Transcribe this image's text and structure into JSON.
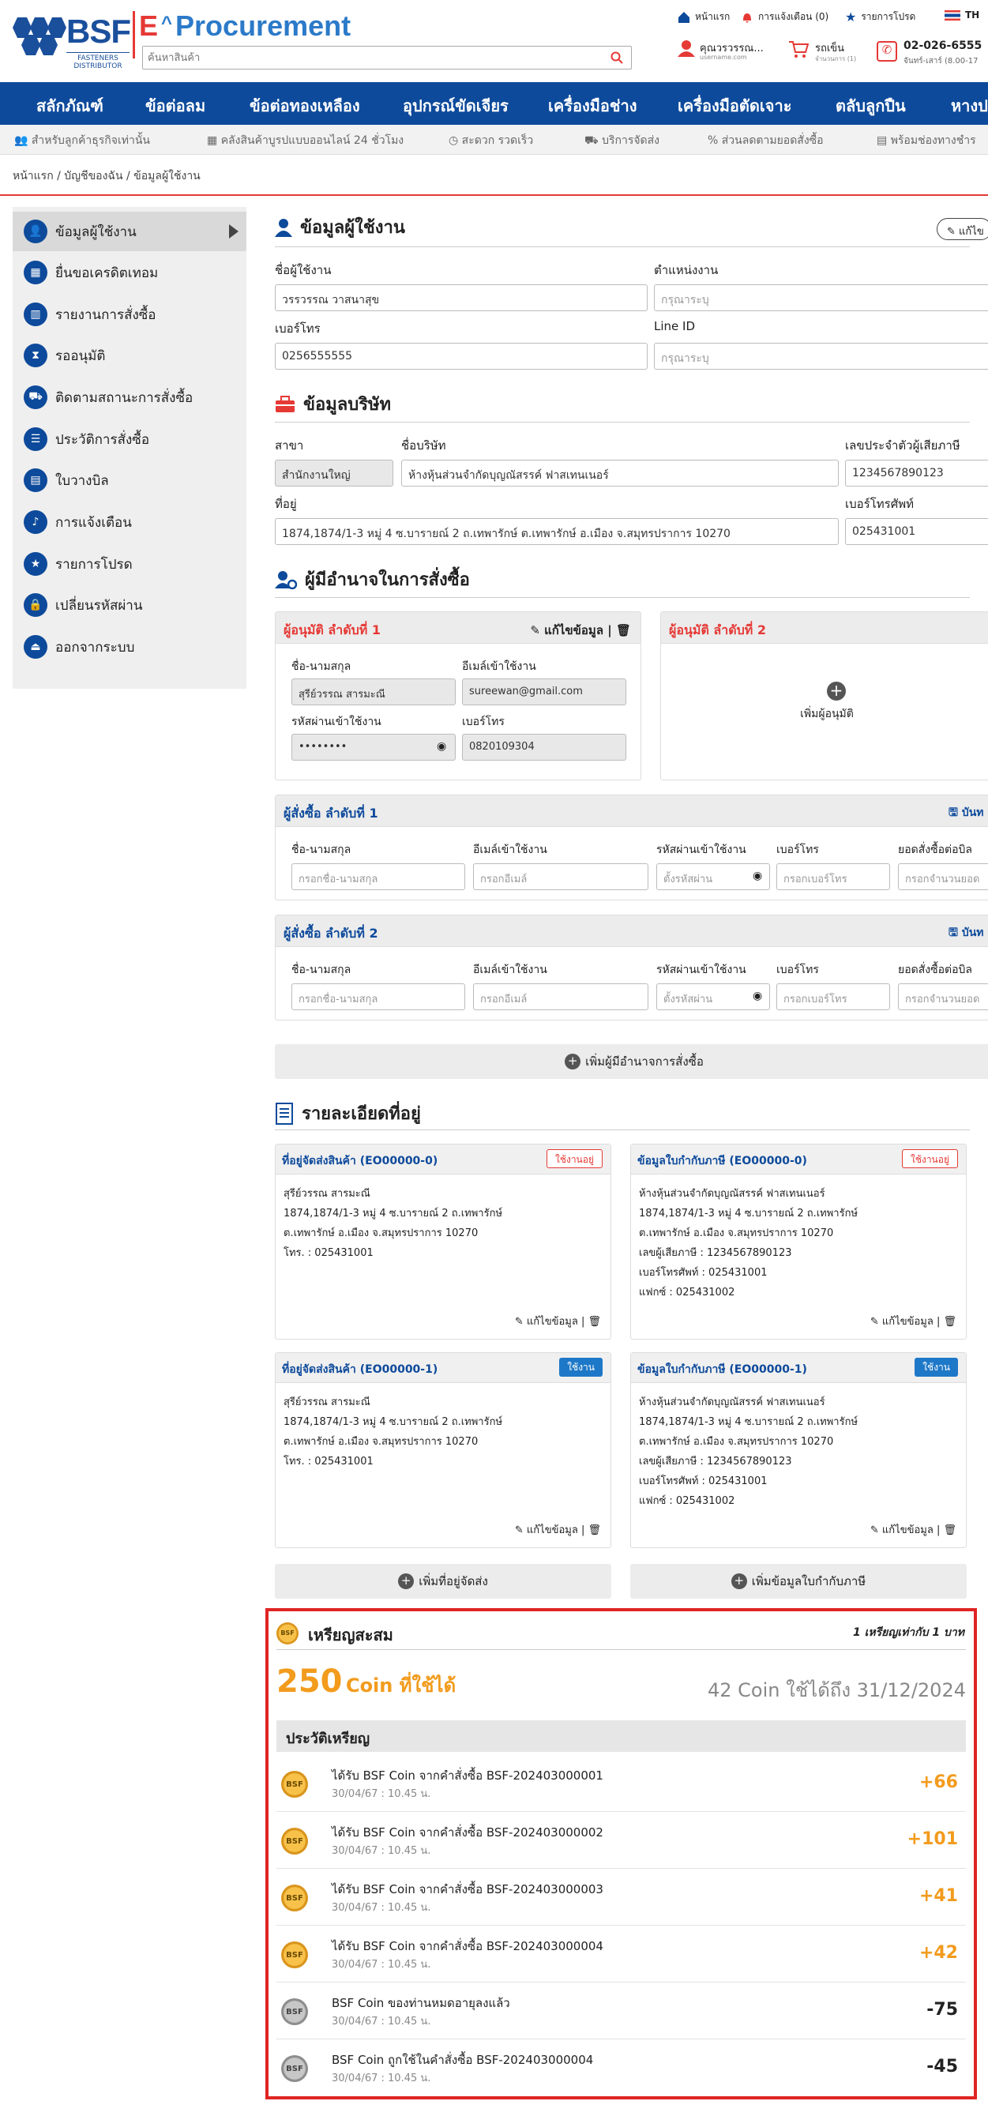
{
  "header": {
    "logo_text": "BSF",
    "logo_sub": "FASTENERS DISTRIBUTOR",
    "title_e": "E",
    "title_rest": "Procurement",
    "search_placeholder": "ค้นหาสินค้า",
    "links": {
      "home": "หน้าแรก",
      "notify": "การแจ้งเตือน (0)",
      "fav": "รายการโปรด",
      "lang": "TH"
    },
    "user_name": "คุณวรวรรณ...",
    "user_sub": "username.com",
    "cart_label": "รถเข็น",
    "cart_sub": "จำนวนการ (1)",
    "phone": "02-026-6555",
    "phone_sub": "จันทร์-เสาร์ (8.00-17"
  },
  "nav": [
    "สลักภัณฑ์",
    "ข้อต่อลม",
    "ข้อต่อทองเหลือง",
    "อุปกรณ์ขัดเจียร",
    "เครื่องมือช่าง",
    "เครื่องมือตัดเจาะ",
    "ตลับลูกปืน",
    "หางปล"
  ],
  "features": [
    "สำหรับลูกค้าธุรกิจเท่านั้น",
    "คลังสินค้าบูรปแบบออนไลน์ 24 ชั่วโมง",
    "สะดวก รวดเร็ว",
    "บริการจัดส่ง",
    "ส่วนลดตามยอดสั่งซื้อ",
    "พร้อมช่องทางชำร"
  ],
  "breadcrumb": "หน้าแรก / บัญชีของฉัน / ข้อมูลผู้ใช้งาน",
  "sidebar": [
    {
      "label": "ข้อมูลผู้ใช้งาน",
      "icon": "user-icon"
    },
    {
      "label": "ยื่นขอเครดิตเทอม",
      "icon": "calendar-icon"
    },
    {
      "label": "รายงานการสั่งซื้อ",
      "icon": "chart-icon"
    },
    {
      "label": "รออนุมัติ",
      "icon": "hourglass-icon"
    },
    {
      "label": "ติดตามสถานะการสั่งซื้อ",
      "icon": "truck-icon"
    },
    {
      "label": "ประวัติการสั่งซื้อ",
      "icon": "list-icon"
    },
    {
      "label": "ใบวางบิล",
      "icon": "document-icon"
    },
    {
      "label": "การแจ้งเตือน",
      "icon": "bell-icon"
    },
    {
      "label": "รายการโปรด",
      "icon": "star-icon"
    },
    {
      "label": "เปลี่ยนรหัสผ่าน",
      "icon": "lock-icon"
    },
    {
      "label": "ออกจากระบบ",
      "icon": "logout-icon"
    }
  ],
  "user_info": {
    "title": "ข้อมูลผู้ใช้งาน",
    "edit": "แก้ไข",
    "username_label": "ชื่อผู้ใช้งาน",
    "username_value": "วรรวรรณ วาสนาสุข",
    "position_label": "ตำแหน่งงาน",
    "position_placeholder": "กรุณาระบุ",
    "phone_label": "เบอร์โทร",
    "phone_value": "0256555555",
    "line_label": "Line ID",
    "line_placeholder": "กรุณาระบุ"
  },
  "company": {
    "title": "ข้อมูลบริษัท",
    "branch_label": "สาขา",
    "branch_value": "สำนักงานใหญ่",
    "name_label": "ชื่อบริษัท",
    "name_value": "ห้างหุ้นส่วนจำกัดบุญณัสรรค์ ฟาสเทนเนอร์",
    "tax_label": "เลขประจำตัวผู้เสียภาษี",
    "tax_value": "1234567890123",
    "address_label": "ที่อยู่",
    "address_value": "1874,1874/1-3 หมู่ 4 ซ.บารายณ์ 2 ถ.เทพารักษ์ ต.เทพารักษ์ อ.เมือง จ.สมุทรปราการ 10270",
    "tel_label": "เบอร์โทรศัพท์",
    "tel_value": "025431001"
  },
  "authority": {
    "title": "ผู้มีอำนาจในการสั่งซื้อ",
    "approver1_title": "ผู้อนุมัติ ลำดับที่ 1",
    "approver1_edit": "แก้ไขข้อมูล",
    "approver2_title": "ผู้อนุมัติ ลำดับที่ 2",
    "add_approver": "เพิ่มผู้อนุมัติ",
    "name_label": "ชื่อ-นามสกุล",
    "email_label": "อีเมล์เข้าใช้งาน",
    "password_label": "รหัสผ่านเข้าใช้งาน",
    "phone_label": "เบอร์โทร",
    "approver1_name": "สุรีย์วรรณ สารมะณี",
    "approver1_email": "sureewan@gmail.com",
    "approver1_password": "••••••••",
    "approver1_phone": "0820109304",
    "buyer1_title": "ผู้สั่งซื้อ ลำดับที่ 1",
    "buyer2_title": "ผู้สั่งซื้อ ลำดับที่ 2",
    "save": "บันท",
    "limit_label": "ยอดสั่งซื้อต่อบิล",
    "ph_name": "กรอกชื่อ-นามสกุล",
    "ph_email": "กรอกอีเมล์",
    "ph_password": "ตั้งรหัสผ่าน",
    "ph_phone": "กรอกเบอร์โทร",
    "ph_limit": "กรอกจำนวนยอด",
    "add_authority": "เพิ่มผู้มีอำนาจการสั่งซื้อ"
  },
  "addresses": {
    "title": "รายละเอียดที่อยู่",
    "edit": "แก้ไขข้อมูล",
    "items": [
      {
        "title": "ที่อยู่จัดส่งสินค้า (EO00000-0)",
        "tag": "ใช้งานอยู่",
        "body": "สุรีย์วรรณ สารมะณี\n1874,1874/1-3 หมู่ 4 ซ.บารายณ์ 2 ถ.เทพารักษ์\nต.เทพารักษ์ อ.เมือง จ.สมุทรปราการ 10270\nโทร. : 025431001"
      },
      {
        "title": "ข้อมูลใบกำกับภาษี (EO00000-0)",
        "tag": "ใช้งานอยู่",
        "body": "ห้างหุ้นส่วนจำกัดบุญณัสรรค์ ฟาสเทนเนอร์\n1874,1874/1-3 หมู่ 4 ซ.บารายณ์ 2 ถ.เทพารักษ์\nต.เทพารักษ์ อ.เมือง จ.สมุทรปราการ 10270\nเลขผู้เสียภาษี : 1234567890123\nเบอร์โทรศัพท์ : 025431001\nแฟกซ์ : 025431002"
      },
      {
        "title": "ที่อยู่จัดส่งสินค้า (EO00000-1)",
        "tag": "ใช้งาน",
        "body": "สุรีย์วรรณ สารมะณี\n1874,1874/1-3 หมู่ 4 ซ.บารายณ์ 2 ถ.เทพารักษ์\nต.เทพารักษ์ อ.เมือง จ.สมุทรปราการ 10270\nโทร. : 025431001"
      },
      {
        "title": "ข้อมูลใบกำกับภาษี (EO00000-1)",
        "tag": "ใช้งาน",
        "body": "ห้างหุ้นส่วนจำกัดบุญณัสรรค์ ฟาสเทนเนอร์\n1874,1874/1-3 หมู่ 4 ซ.บารายณ์ 2 ถ.เทพารักษ์\nต.เทพารักษ์ อ.เมือง จ.สมุทรปราการ 10270\nเลขผู้เสียภาษี : 1234567890123\nเบอร์โทรศัพท์ : 025431001\nแฟกซ์ : 025431002"
      }
    ],
    "add_shipping": "เพิ่มที่อยู่จัดส่ง",
    "add_tax": "เพิ่มข้อมูลใบกำกับภาษี"
  },
  "coins": {
    "title": "เหรียญสะสม",
    "rate": "1 เหรียญเท่ากับ 1 บาท",
    "available_number": "250",
    "available_text": "Coin ที่ใช้ได้",
    "expiring": "42 Coin ใช้ได้ถึง 31/12/2024",
    "history_title": "ประวัติเหรียญ",
    "coin_label": "BSF",
    "history": [
      {
        "text": "ได้รับ BSF Coin จากคำสั่งซื้อ BSF-202403000001",
        "date": "30/04/67 : 10.45 น.",
        "value": "+66",
        "kind": "gold"
      },
      {
        "text": "ได้รับ BSF Coin จากคำสั่งซื้อ BSF-202403000002",
        "date": "30/04/67 : 10.45 น.",
        "value": "+101",
        "kind": "gold"
      },
      {
        "text": "ได้รับ BSF Coin จากคำสั่งซื้อ BSF-202403000003",
        "date": "30/04/67 : 10.45 น.",
        "value": "+41",
        "kind": "gold"
      },
      {
        "text": "ได้รับ BSF Coin จากคำสั่งซื้อ BSF-202403000004",
        "date": "30/04/67 : 10.45 น.",
        "value": "+42",
        "kind": "gold"
      },
      {
        "text": "BSF Coin ของท่านหมดอายุลงแล้ว",
        "date": "30/04/67 : 10.45 น.",
        "value": "-75",
        "kind": "gray"
      },
      {
        "text": "BSF Coin ถูกใช้ในคำสั่งซื้อ BSF-202403000004",
        "date": "30/04/67 : 10.45 น.",
        "value": "-45",
        "kind": "gray"
      }
    ]
  },
  "colors": {
    "brand_blue": "#0d4a9b",
    "accent_red": "#e53935",
    "coin_orange": "#f29b1d"
  }
}
